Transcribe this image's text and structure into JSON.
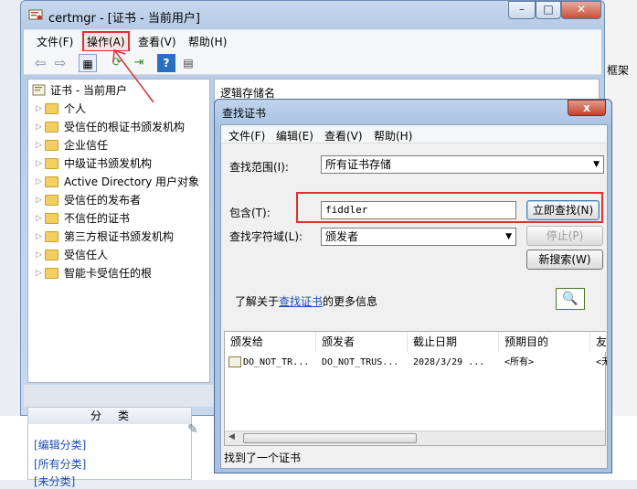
{
  "main_window": {
    "title": "certmgr - [证书 - 当前用户]",
    "min": "–",
    "max": "□",
    "close": "✕",
    "menu": [
      "文件(F)",
      "操作(A)",
      "查看(V)",
      "帮助(H)"
    ],
    "tree_root": "证书 - 当前用户",
    "tree_items": [
      "个人",
      "受信任的根证书颁发机构",
      "企业信任",
      "中级证书颁发机构",
      "Active Directory 用户对象",
      "受信任的发布者",
      "不信任的证书",
      "第三方根证书颁发机构",
      "受信任人",
      "智能卡受信任的根"
    ],
    "right_header": "逻辑存储名"
  },
  "right_edge_text": "框架",
  "bottom_panel": {
    "header": "分类",
    "links": [
      "[编辑分类]",
      "[所有分类]",
      "[未分类]"
    ]
  },
  "find_dialog": {
    "title": "查找证书",
    "close": "x",
    "menu": [
      "文件(F)",
      "编辑(E)",
      "查看(V)",
      "帮助(H)"
    ],
    "scope_label": "查找范围(I):",
    "scope_value": "所有证书存储",
    "contains_label": "包含(T):",
    "contains_value": "fiddler",
    "field_label": "查找字符域(L):",
    "field_value": "颁发者",
    "find_now": "立即查找(N)",
    "stop": "停止(P)",
    "new_search": "新搜索(W)",
    "learn_prefix": "了解关于",
    "learn_link": "查找证书",
    "learn_suffix": "的更多信息",
    "columns": [
      "颁发给",
      "颁发者",
      "截止日期",
      "预期目的",
      "友好"
    ],
    "rows": [
      {
        "issued_to": "DO_NOT_TR...",
        "issuer": "DO_NOT_TRUS...",
        "expires": "2028/3/29 ...",
        "purpose": "<所有>",
        "friendly": "<无>"
      }
    ],
    "status": "找到了一个证书"
  }
}
